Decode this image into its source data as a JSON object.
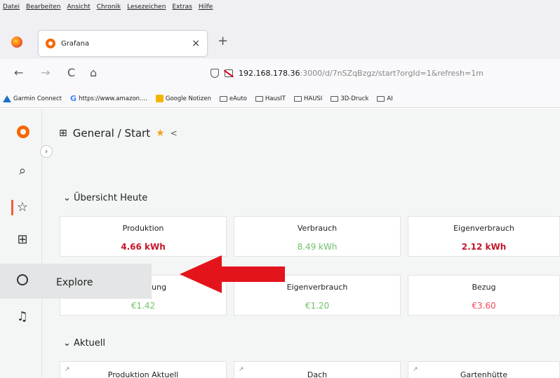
{
  "menubar": [
    "Datei",
    "Bearbeiten",
    "Ansicht",
    "Chronik",
    "Lesezeichen",
    "Extras",
    "Hilfe"
  ],
  "tab": {
    "title": "Grafana",
    "close": "×",
    "new": "+"
  },
  "nav": {
    "back": "←",
    "forward": "→",
    "reload": "C",
    "home": "⌂",
    "url_host": "192.168.178.36",
    "url_rest": ":3000/d/7nSZqBzgz/start?orgId=1&refresh=1m"
  },
  "bookmarks": [
    {
      "label": "Garmin Connect",
      "icon": "garmin-triangle-icon"
    },
    {
      "label": "https://www.amazon....",
      "icon": "google-g-icon"
    },
    {
      "label": "Google Notizen",
      "icon": "notes-icon"
    },
    {
      "label": "eAuto",
      "icon": "folder-icon"
    },
    {
      "label": "HausIT",
      "icon": "folder-icon"
    },
    {
      "label": "HAUSI",
      "icon": "folder-icon"
    },
    {
      "label": "3D-Druck",
      "icon": "folder-icon"
    },
    {
      "label": "AI",
      "icon": "folder-icon"
    }
  ],
  "sidebar": {
    "expand": "›",
    "explore_label": "Explore",
    "icons": [
      "search-icon",
      "star-icon",
      "dashboards-icon",
      "explore-icon",
      "alert-bell-icon"
    ]
  },
  "dashboard": {
    "breadcrumb": "General / Start",
    "rows": [
      {
        "title": "Übersicht Heute"
      },
      {
        "title": "Aktuell"
      }
    ],
    "panels": [
      {
        "title": "Produktion",
        "value": "4.66 kWh",
        "color": "#c4162a"
      },
      {
        "title": "Verbrauch",
        "value": "8.49 kWh",
        "color": "#73bf69"
      },
      {
        "title": "Eigenverbrauch",
        "value": "2.12 kWh",
        "color": "#c4162a"
      },
      {
        "title": "Einspeisung",
        "value": "€1.42",
        "color": "#73bf69"
      },
      {
        "title": "Eigenverbrauch",
        "value": "€1.20",
        "color": "#73bf69"
      },
      {
        "title": "Bezug",
        "value": "€3.60",
        "color": "#f2495c"
      },
      {
        "title": "Produktion Aktuell",
        "value": "",
        "color": "#222222"
      },
      {
        "title": "Dach",
        "value": "",
        "color": "#222222"
      },
      {
        "title": "Gartenhütte",
        "value": "",
        "color": "#222222"
      }
    ]
  },
  "annotation": {
    "arrow_color": "#e3141c"
  }
}
